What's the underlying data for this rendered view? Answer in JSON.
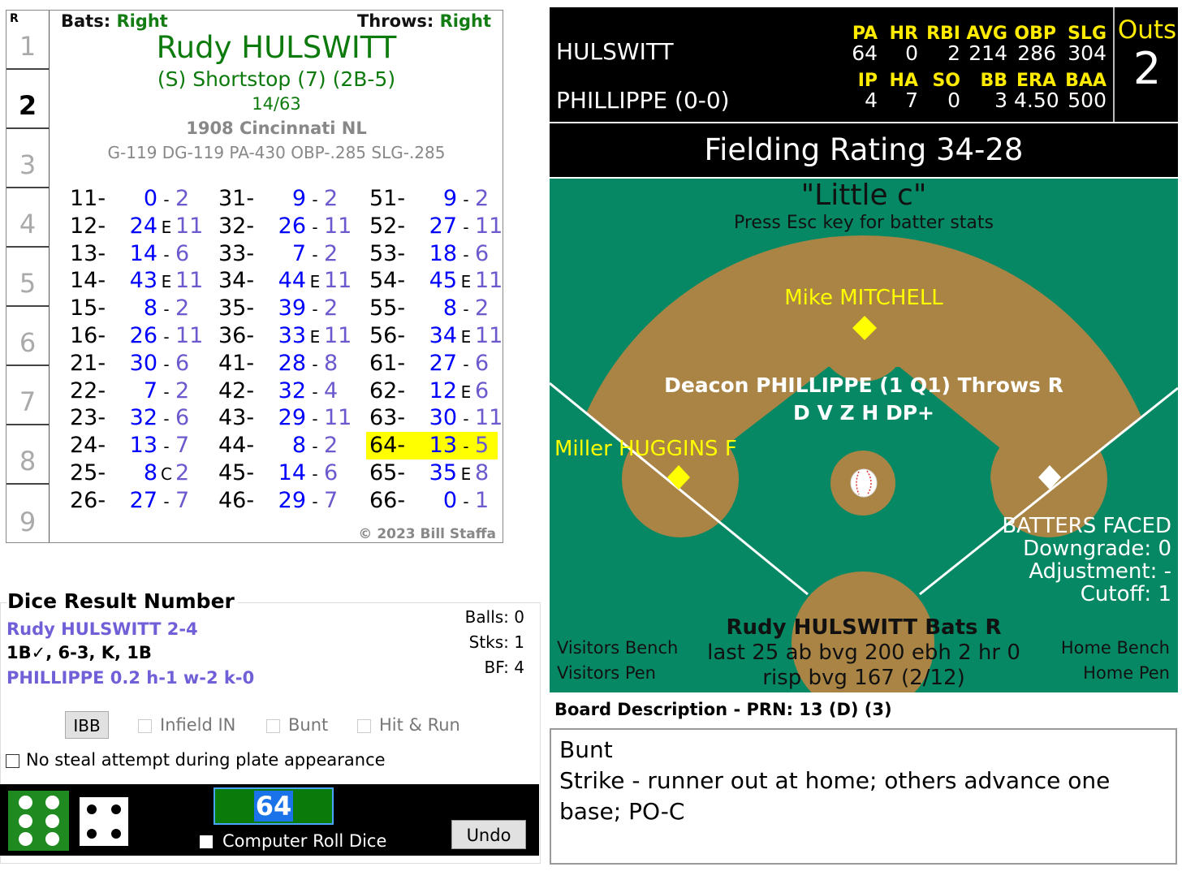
{
  "card": {
    "hand_label": "R",
    "row_numbers": [
      "1",
      "2",
      "3",
      "4",
      "5",
      "6",
      "7",
      "8",
      "9"
    ],
    "current_row": "2",
    "bats_label": "Bats:",
    "bats_value": "Right",
    "throws_label": "Throws:",
    "throws_value": "Right",
    "player_name": "Rudy HULSWITT",
    "position": "(S) Shortstop (7) (2B-5)",
    "fraction": "14/63",
    "team": "1908 Cincinnati NL",
    "stats": "G-119 DG-119 PA-430 OBP-.285 SLG-.285",
    "copyright": "© 2023 Bill Staffa",
    "grid": [
      [
        {
          "roll": "11-",
          "a": "0",
          "s": "-",
          "b": "2"
        },
        {
          "roll": "12-",
          "a": "24",
          "s": "E",
          "b": "11"
        },
        {
          "roll": "13-",
          "a": "14",
          "s": "-",
          "b": "6"
        },
        {
          "roll": "14-",
          "a": "43",
          "s": "E",
          "b": "11"
        },
        {
          "roll": "15-",
          "a": "8",
          "s": "-",
          "b": "2"
        },
        {
          "roll": "16-",
          "a": "26",
          "s": "-",
          "b": "11"
        },
        {
          "roll": "21-",
          "a": "30",
          "s": "-",
          "b": "6"
        },
        {
          "roll": "22-",
          "a": "7",
          "s": "-",
          "b": "2"
        },
        {
          "roll": "23-",
          "a": "32",
          "s": "-",
          "b": "6"
        },
        {
          "roll": "24-",
          "a": "13",
          "s": "-",
          "b": "7"
        },
        {
          "roll": "25-",
          "a": "8",
          "s": "C",
          "b": "2"
        },
        {
          "roll": "26-",
          "a": "27",
          "s": "-",
          "b": "7"
        }
      ],
      [
        {
          "roll": "31-",
          "a": "9",
          "s": "-",
          "b": "2"
        },
        {
          "roll": "32-",
          "a": "26",
          "s": "-",
          "b": "11"
        },
        {
          "roll": "33-",
          "a": "7",
          "s": "-",
          "b": "2"
        },
        {
          "roll": "34-",
          "a": "44",
          "s": "E",
          "b": "11"
        },
        {
          "roll": "35-",
          "a": "39",
          "s": "-",
          "b": "2"
        },
        {
          "roll": "36-",
          "a": "33",
          "s": "E",
          "b": "11"
        },
        {
          "roll": "41-",
          "a": "28",
          "s": "-",
          "b": "8"
        },
        {
          "roll": "42-",
          "a": "32",
          "s": "-",
          "b": "4"
        },
        {
          "roll": "43-",
          "a": "29",
          "s": "-",
          "b": "11"
        },
        {
          "roll": "44-",
          "a": "8",
          "s": "-",
          "b": "2"
        },
        {
          "roll": "45-",
          "a": "14",
          "s": "-",
          "b": "6"
        },
        {
          "roll": "46-",
          "a": "29",
          "s": "-",
          "b": "7"
        }
      ],
      [
        {
          "roll": "51-",
          "a": "9",
          "s": "-",
          "b": "2"
        },
        {
          "roll": "52-",
          "a": "27",
          "s": "-",
          "b": "11"
        },
        {
          "roll": "53-",
          "a": "18",
          "s": "-",
          "b": "6"
        },
        {
          "roll": "54-",
          "a": "45",
          "s": "E",
          "b": "11"
        },
        {
          "roll": "55-",
          "a": "8",
          "s": "-",
          "b": "2"
        },
        {
          "roll": "56-",
          "a": "34",
          "s": "E",
          "b": "11"
        },
        {
          "roll": "61-",
          "a": "27",
          "s": "-",
          "b": "6"
        },
        {
          "roll": "62-",
          "a": "12",
          "s": "E",
          "b": "6"
        },
        {
          "roll": "63-",
          "a": "30",
          "s": "-",
          "b": "11"
        },
        {
          "roll": "64-",
          "a": "13",
          "s": "-",
          "b": "5",
          "highlight": true
        },
        {
          "roll": "65-",
          "a": "35",
          "s": "E",
          "b": "8"
        },
        {
          "roll": "66-",
          "a": "0",
          "s": "-",
          "b": "1"
        }
      ]
    ],
    "highlight_color": "#ffff00"
  },
  "dice_result": {
    "title": "Dice Result Number",
    "batter_line": "Rudy HULSWITT  2-4",
    "batter_results": "1B✓, 6-3, K, 1B",
    "pitcher_line": "PHILLIPPE  0.2  h-1  w-2  k-0",
    "balls": "Balls: 0",
    "strikes": "Stks: 1",
    "bf": "BF: 4",
    "ibb_label": "IBB",
    "infield_in_label": "Infield IN",
    "bunt_label": "Bunt",
    "hit_run_label": "Hit & Run",
    "no_steal_label": "No steal attempt during plate appearance",
    "die1": 6,
    "die2": 4,
    "roll_value": "64",
    "computer_roll_label": "Computer Roll Dice",
    "undo_label": "Undo"
  },
  "scoreboard": {
    "batter_name": "HULSWITT",
    "batter_headers": [
      "PA",
      "HR",
      "RBI",
      "AVG",
      "OBP",
      "SLG"
    ],
    "batter_values": [
      "64",
      "0",
      "2",
      "214",
      "286",
      "304"
    ],
    "pitcher_name": "PHILLIPPE (0-0)",
    "pitcher_headers": [
      "IP",
      "HA",
      "SO",
      "BB",
      "ERA",
      "BAA"
    ],
    "pitcher_values": [
      "4",
      "7",
      "0",
      "3",
      "4.50",
      "500"
    ],
    "outs_label": "Outs",
    "outs_value": "2"
  },
  "fielding_rating": "Fielding Rating 34-28",
  "field": {
    "park_name": "\"Little c\"",
    "hint": "Press Esc key for batter stats",
    "runner_second": "Mike MITCHELL",
    "runner_third": "Miller HUGGINS F",
    "pitcher_line": "Deacon PHILLIPPE (1 Q1) Throws R",
    "pitcher_ratings": "D V Z H DP+",
    "batters_faced_title": "BATTERS FACED",
    "downgrade": "Downgrade: 0",
    "adjustment": "Adjustment: -",
    "cutoff": "Cutoff: 1",
    "batter_line": "Rudy HULSWITT Bats R",
    "batter_last25": "last 25 ab bvg 200 ebh 2 hr 0",
    "batter_risp": "risp bvg 167 (2/12)",
    "visitors_bench": "Visitors Bench",
    "visitors_pen": "Visitors Pen",
    "home_bench": "Home Bench",
    "home_pen": "Home Pen",
    "grass_color": "#078864",
    "dirt_color": "#a98445",
    "runner_color": "#ffff00"
  },
  "board_description": {
    "label": "Board Description - PRN: 13 (D) (3)",
    "line1": "Bunt",
    "line2": "Strike - runner out at home; others advance one base; PO-C"
  }
}
